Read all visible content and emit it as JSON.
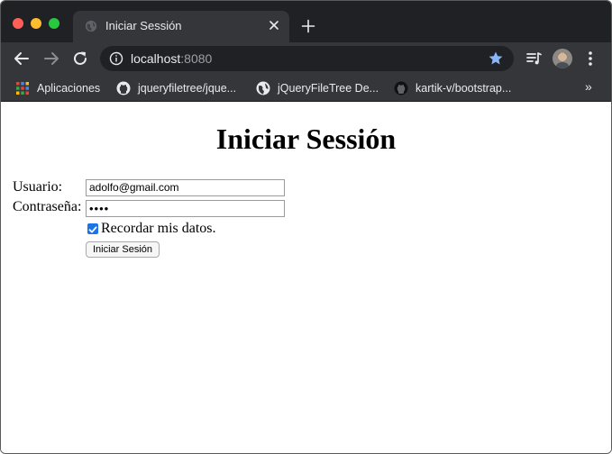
{
  "browser": {
    "tab": {
      "title": "Iniciar Sessión",
      "favicon": "globe-icon"
    },
    "address_bar": {
      "host": "localhost",
      "port": ":8080"
    },
    "bookmarks": [
      {
        "label": "Aplicaciones",
        "icon": "apps-grid-icon"
      },
      {
        "label": "jqueryfiletree/jque...",
        "icon": "github-icon"
      },
      {
        "label": "jQueryFileTree De...",
        "icon": "globe-icon"
      },
      {
        "label": "kartik-v/bootstrap...",
        "icon": "github-icon"
      }
    ],
    "bookmarks_overflow": "»",
    "colors": {
      "frame": "#202124",
      "toolbar": "#35363a",
      "star": "#8ab4f8"
    }
  },
  "page": {
    "title": "Iniciar Sessión",
    "form": {
      "username_label": "Usuario:",
      "username_value": "adolfo@gmail.com",
      "password_label": "Contraseña:",
      "password_value": "••••",
      "remember_label": "Recordar mis datos.",
      "remember_checked": true,
      "submit_label": "Iniciar Sesión"
    },
    "colors": {
      "checkbox": "#1a73e8"
    }
  }
}
